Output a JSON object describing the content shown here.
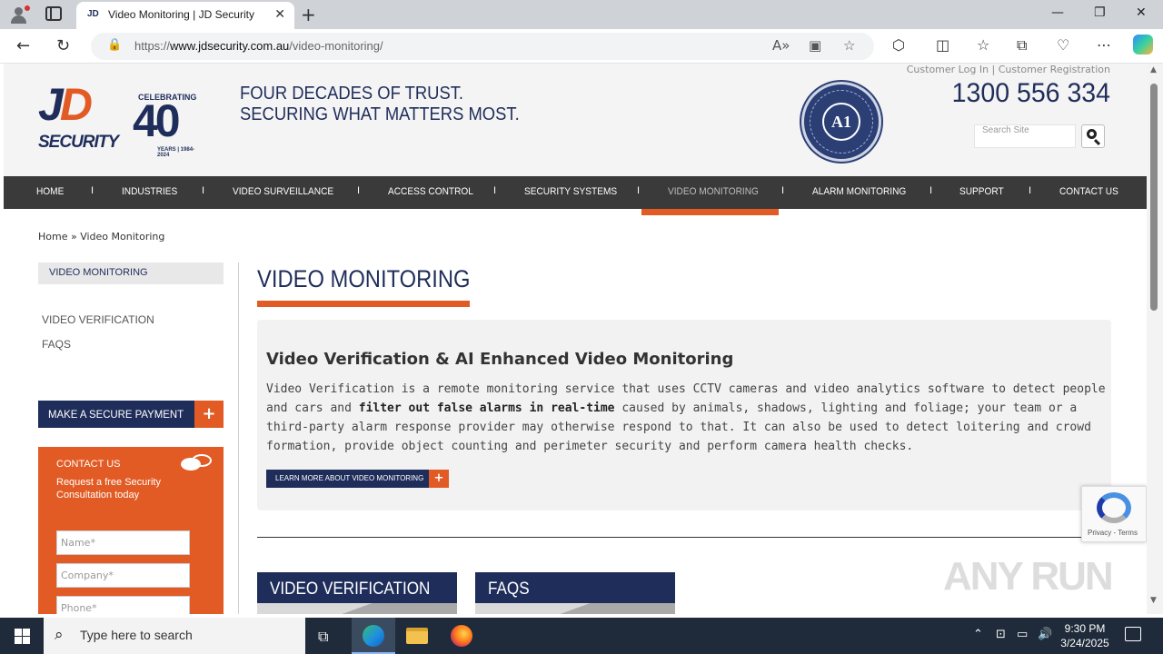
{
  "browser": {
    "tab_title": "Video Monitoring | JD Security",
    "tab_favicon": "JD",
    "url_prefix": "https://",
    "url_domain": "www.jdsecurity.com.au",
    "url_path": "/video-monitoring/"
  },
  "header": {
    "logo": {
      "celebrating": "CELEBRATING",
      "forty": "40",
      "years": "YEARS | 1984-2024"
    },
    "tagline_line1": "FOUR DECADES OF TRUST.",
    "tagline_line2": "SECURING WHAT MATTERS MOST.",
    "badge_text": "A1",
    "links": "Customer Log In | Customer Registration",
    "phone": "1300 556 334",
    "search_placeholder": "Search Site"
  },
  "nav": {
    "items": [
      {
        "label": "HOME"
      },
      {
        "label": "INDUSTRIES"
      },
      {
        "label": "VIDEO SURVEILLANCE"
      },
      {
        "label": "ACCESS CONTROL"
      },
      {
        "label": "SECURITY SYSTEMS"
      },
      {
        "label": "VIDEO MONITORING",
        "active": true
      },
      {
        "label": "ALARM MONITORING"
      },
      {
        "label": "SUPPORT"
      },
      {
        "label": "CONTACT US"
      }
    ],
    "separator": "I"
  },
  "breadcrumb": "Home » Video Monitoring",
  "sidebar": {
    "title": "VIDEO MONITORING",
    "links": [
      "VIDEO VERIFICATION",
      "FAQS"
    ],
    "pay_button": "MAKE A SECURE PAYMENT",
    "contact": {
      "title": "CONTACT US",
      "subtitle": "Request a free Security Consultation today",
      "fields": [
        "Name*",
        "Company*",
        "Phone*"
      ]
    }
  },
  "main": {
    "page_title": "VIDEO MONITORING",
    "card_title": "Video Verification & AI Enhanced Video Monitoring",
    "card_text_1": "Video Verification is a remote monitoring service that uses CCTV cameras and video analytics software to detect people and cars and ",
    "card_text_bold": "filter out false alarms in real-time",
    "card_text_2": " caused by animals, shadows, lighting and foliage; your team or a third-party alarm response provider may otherwise respond to that. It can also be used to detect loitering and crowd formation, provide object counting and perimeter security and perform camera health checks.",
    "learn_button": "LEARN MORE ABOUT VIDEO MONITORING",
    "tiles": [
      "VIDEO VERIFICATION",
      "FAQS"
    ]
  },
  "recaptcha_terms": "Privacy - Terms",
  "watermark": "ANY RUN",
  "taskbar": {
    "search_text": "Type here to search",
    "time": "9:30 PM",
    "date": "3/24/2025"
  },
  "colors": {
    "navy": "#1f2d5a",
    "orange": "#e25b25",
    "nav_bg": "#3a3a3a"
  }
}
